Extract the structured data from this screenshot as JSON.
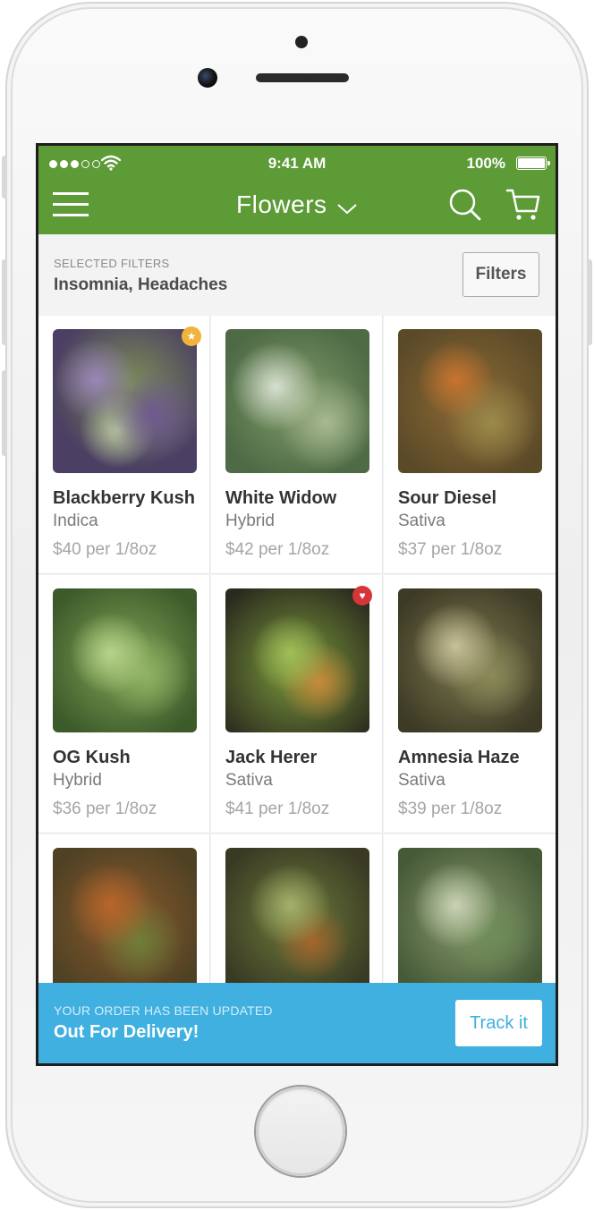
{
  "status_bar": {
    "time": "9:41 AM",
    "battery": "100%"
  },
  "header": {
    "title": "Flowers",
    "bg_color": "#5d9b37"
  },
  "filters": {
    "caption": "SELECTED FILTERS",
    "value": "Insomnia, Headaches",
    "button_label": "Filters"
  },
  "products": [
    {
      "name": "Blackberry Kush",
      "type": "Indica",
      "price": "$40 per 1/8oz",
      "badge": "star"
    },
    {
      "name": "White Widow",
      "type": "Hybrid",
      "price": "$42 per 1/8oz",
      "badge": ""
    },
    {
      "name": "Sour Diesel",
      "type": "Sativa",
      "price": "$37 per 1/8oz",
      "badge": ""
    },
    {
      "name": "OG Kush",
      "type": "Hybrid",
      "price": "$36 per 1/8oz",
      "badge": ""
    },
    {
      "name": "Jack Herer",
      "type": "Sativa",
      "price": "$41 per 1/8oz",
      "badge": "heart"
    },
    {
      "name": "Amnesia Haze",
      "type": "Sativa",
      "price": "$39 per 1/8oz",
      "badge": ""
    },
    {
      "name": "",
      "type": "",
      "price": "",
      "badge": ""
    },
    {
      "name": "",
      "type": "",
      "price": "",
      "badge": ""
    },
    {
      "name": "",
      "type": "",
      "price": "",
      "badge": ""
    }
  ],
  "banner": {
    "caption": "YOUR ORDER HAS BEEN UPDATED",
    "title": "Out For Delivery!",
    "button_label": "Track it",
    "bg_color": "#3fb0df"
  }
}
